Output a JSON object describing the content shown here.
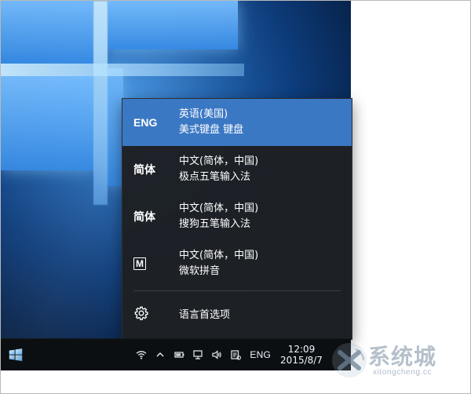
{
  "flyout": {
    "items": [
      {
        "abbr": "ENG",
        "line1": "英语(美国)",
        "line2": "美式键盘 键盘",
        "selected": true
      },
      {
        "abbr": "简体",
        "line1": "中文(简体，中国)",
        "line2": "极点五笔输入法",
        "selected": false
      },
      {
        "abbr": "简体",
        "line1": "中文(简体，中国)",
        "line2": "搜狗五笔输入法",
        "selected": false
      },
      {
        "abbr": "M",
        "line1": "中文(简体，中国)",
        "line2": "微软拼音",
        "selected": false
      }
    ],
    "settings_label": "语言首选项"
  },
  "taskbar": {
    "language_indicator": "ENG",
    "clock": {
      "time": "12:09",
      "date": "2015/8/7"
    }
  },
  "colors": {
    "flyout_bg": "#1e2125",
    "selected_bg": "#3b78c4",
    "taskbar_bg": "#0c0f12"
  },
  "icons": {
    "start": "windows-logo-icon",
    "wifi": "wifi-icon",
    "chevron": "chevron-up-icon",
    "battery": "battery-icon",
    "network": "network-icon",
    "volume": "volume-icon",
    "input": "input-method-icon",
    "settings": "gear-icon",
    "notification": "notification-icon"
  },
  "watermark": {
    "brand": "系统城",
    "url": "xitongcheng.cc"
  }
}
